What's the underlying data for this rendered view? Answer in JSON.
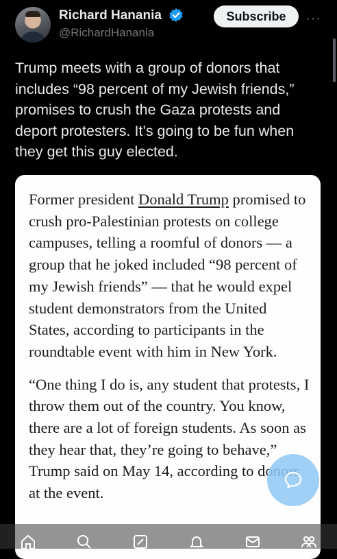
{
  "author": {
    "name": "Richard Hanania",
    "handle": "@RichardHanania",
    "verified_color": "#1d9bf0"
  },
  "actions": {
    "subscribe_label": "Subscribe",
    "more_label": "···"
  },
  "tweet": {
    "text": "Trump meets with a group of donors that includes “98 percent of my Jewish friends,” promises to crush the Gaza protests and deport protesters. It’s going to be fun when they get this guy elected."
  },
  "article": {
    "p1_before": "Former president ",
    "p1_link": "Donald Trump",
    "p1_after": " promised to crush pro-Palestinian protests on college campuses, telling a roomful of donors — a group that he joked included “98 percent of my Jewish friends” — that he would expel student demonstrators from the United States, according to participants in the roundtable event with him in New York.",
    "p2": "“One thing I do is, any student that protests, I throw them out of the country. You know, there are a lot of foreign students. As soon as they hear that, they’re going to behave,” Trump said on May 14, according to donors at the event."
  },
  "nav": {
    "items": [
      "home-icon",
      "search-icon",
      "compose-icon",
      "notifications-icon",
      "messages-icon",
      "communities-icon"
    ]
  },
  "colors": {
    "background": "#000000",
    "text": "#e7e9ea",
    "secondary": "#71767b",
    "fab": "#8fc8f5"
  }
}
